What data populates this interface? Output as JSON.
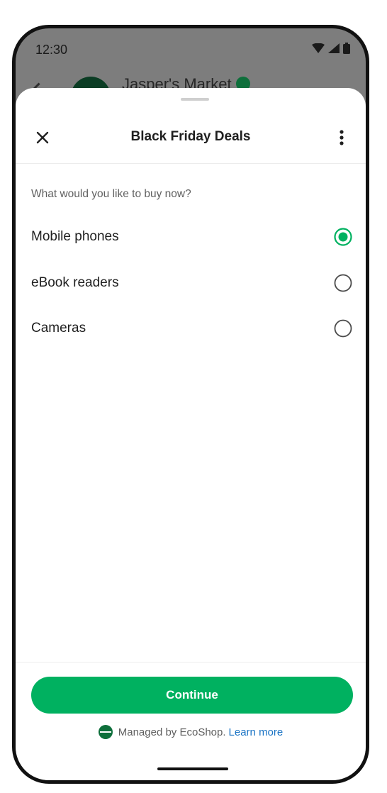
{
  "status_bar": {
    "time": "12:30",
    "icons": [
      "wifi-icon",
      "signal-icon",
      "battery-icon"
    ]
  },
  "background_app": {
    "title": "Jasper's Market",
    "verified_icon": "verified-check-icon"
  },
  "sheet": {
    "title": "Black Friday Deals",
    "close_icon": "close-icon",
    "menu_icon": "more-vert-icon",
    "question": "What would you like to buy now?",
    "options": [
      {
        "label": "Mobile phones",
        "selected": true
      },
      {
        "label": "eBook readers",
        "selected": false
      },
      {
        "label": "Cameras",
        "selected": false
      }
    ],
    "continue_label": "Continue",
    "managed_by": "Managed by EcoShop.",
    "learn_more": "Learn more"
  },
  "colors": {
    "accent": "#00b160",
    "brand_dark": "#0e6f3b",
    "link": "#1a73c4",
    "scrim": "#7d7d7d"
  }
}
